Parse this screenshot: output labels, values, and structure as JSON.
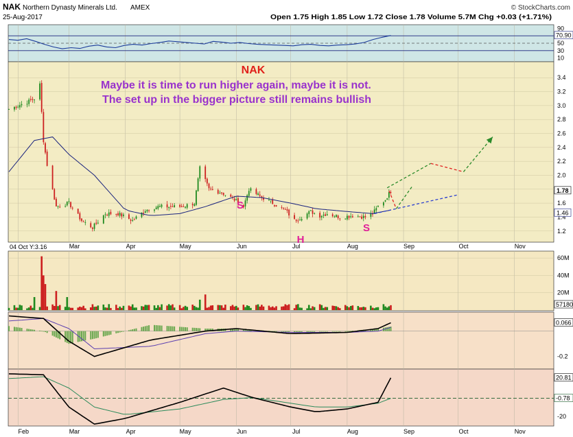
{
  "header": {
    "symbol": "NAK",
    "company": "Northern Dynasty Minerals Ltd.",
    "exchange": "AMEX",
    "date": "25-Aug-2017",
    "brand": "© StockCharts.com",
    "quote": "Open 1.75  High 1.85  Low 1.72  Close 1.78  Volume 5.7M  Chg +0.03 (+1.71%)"
  },
  "annotations": {
    "title": "NAK",
    "line1": "Maybe it is time to run higher again, maybe it is not.",
    "line2": "The set up in the bigger picture still remains bullish",
    "pattern_left_shoulder": "S",
    "pattern_head": "H",
    "pattern_right_shoulder": "S"
  },
  "crosshair_label": "04 Oct Y:3.16",
  "colors": {
    "up": "#1f8a1f",
    "down": "#cc1f1f",
    "ma": "#1a237e",
    "annotation_text": "#9932cc",
    "title_text": "#e0201a",
    "pattern_text": "#e0209a",
    "projection_green": "#2a8a2a",
    "projection_red": "#e02020",
    "projection_blue": "#2b3fd0",
    "rsi_bg": "#cfe6e6",
    "price_bg": "#f3ecc4",
    "volume_bg": "#f5e8c2",
    "macd_bg": "#f7e0c8",
    "osc_bg": "#f5d8c8"
  },
  "chart_data": [
    {
      "type": "line",
      "panel": "RSI",
      "y_ticks": [
        "90",
        "70",
        "50",
        "30",
        "10"
      ],
      "ylim": [
        0,
        100
      ],
      "last_label": "70.90",
      "reference_lines": [
        70,
        50,
        30
      ],
      "series": [
        {
          "values": [
            60,
            58,
            62,
            55,
            47,
            40,
            35,
            38,
            36,
            42,
            45,
            40,
            38,
            44,
            47,
            45,
            49,
            52,
            56,
            54,
            52,
            50,
            48,
            55,
            53,
            50,
            52,
            49,
            47,
            46,
            45,
            44,
            43,
            46,
            47,
            44,
            43,
            45,
            46,
            48,
            52,
            60,
            66,
            70.9
          ]
        }
      ]
    },
    {
      "type": "candlestick",
      "panel": "price",
      "x_ticks": [
        "Feb",
        "Mar",
        "Apr",
        "May",
        "Jun",
        "Jul",
        "Aug",
        "Sep",
        "Oct",
        "Nov"
      ],
      "y_ticks": [
        "3.4",
        "3.2",
        "3.0",
        "2.8",
        "2.6",
        "2.4",
        "2.2",
        "2.0",
        "1.8",
        "1.6",
        "1.4",
        "1.2"
      ],
      "ylim": [
        1.05,
        3.55
      ],
      "last_price_label": "1.78",
      "ma_label": "1.46",
      "series": [
        {
          "name": "price_anchor_dates",
          "values": [
            "2017-01-27",
            "2017-02-01",
            "2017-02-06",
            "2017-02-10",
            "2017-02-13",
            "2017-02-15",
            "2017-02-17",
            "2017-02-22",
            "2017-03-01",
            "2017-03-08",
            "2017-03-14",
            "2017-03-21",
            "2017-03-28",
            "2017-04-05",
            "2017-04-12",
            "2017-04-19",
            "2017-04-25",
            "2017-05-02",
            "2017-05-09",
            "2017-05-12",
            "2017-05-17",
            "2017-05-24",
            "2017-05-31",
            "2017-06-05",
            "2017-06-08",
            "2017-06-14",
            "2017-06-21",
            "2017-06-28",
            "2017-07-03",
            "2017-07-07",
            "2017-07-12",
            "2017-07-17",
            "2017-07-21",
            "2017-07-28",
            "2017-08-04",
            "2017-08-11",
            "2017-08-15",
            "2017-08-18",
            "2017-08-22",
            "2017-08-25"
          ]
        },
        {
          "name": "price_anchor_closes",
          "values": [
            2.95,
            3.0,
            3.05,
            3.1,
            3.3,
            2.5,
            2.15,
            1.55,
            1.6,
            1.35,
            1.25,
            1.45,
            1.45,
            1.35,
            1.5,
            1.55,
            1.55,
            1.55,
            1.6,
            2.1,
            1.8,
            1.75,
            1.65,
            1.55,
            1.8,
            1.7,
            1.6,
            1.5,
            1.35,
            1.4,
            1.48,
            1.42,
            1.45,
            1.4,
            1.42,
            1.4,
            1.45,
            1.55,
            1.65,
            1.78
          ]
        },
        {
          "name": "moving_average_dates",
          "values": [
            "2017-01-27",
            "2017-02-10",
            "2017-02-20",
            "2017-03-01",
            "2017-03-15",
            "2017-04-01",
            "2017-04-15",
            "2017-05-01",
            "2017-05-15",
            "2017-06-01",
            "2017-06-15",
            "2017-07-01",
            "2017-07-15",
            "2017-08-01",
            "2017-08-15",
            "2017-08-25"
          ]
        },
        {
          "name": "moving_average_values",
          "values": [
            2.05,
            2.5,
            2.55,
            2.3,
            2.0,
            1.5,
            1.42,
            1.45,
            1.55,
            1.7,
            1.68,
            1.6,
            1.52,
            1.48,
            1.45,
            1.5
          ]
        }
      ],
      "projections": [
        {
          "color": "green",
          "style": "dashed",
          "from": [
            "2017-08-23",
            1.82
          ],
          "to": [
            "2017-09-16",
            2.17
          ],
          "arrow": false
        },
        {
          "color": "red",
          "style": "dashed",
          "from": [
            "2017-09-16",
            2.17
          ],
          "to": [
            "2017-10-04",
            2.05
          ],
          "arrow": false
        },
        {
          "color": "green",
          "style": "dashed",
          "from": [
            "2017-10-04",
            2.05
          ],
          "to": [
            "2017-10-20",
            2.55
          ],
          "arrow": true
        },
        {
          "color": "red",
          "style": "dashed",
          "from": [
            "2017-08-24",
            1.78
          ],
          "to": [
            "2017-08-28",
            1.52
          ],
          "arrow": false
        },
        {
          "color": "green",
          "style": "dashed",
          "from": [
            "2017-08-28",
            1.52
          ],
          "to": [
            "2017-09-06",
            1.85
          ],
          "arrow": false
        },
        {
          "color": "blue",
          "style": "dashed",
          "from": [
            "2017-08-16",
            1.45
          ],
          "to": [
            "2017-10-01",
            1.72
          ],
          "arrow": false
        }
      ]
    },
    {
      "type": "bar",
      "panel": "volume",
      "y_ticks": [
        "60M",
        "40M",
        "20M"
      ],
      "ylim": [
        0,
        68
      ],
      "last_label": "57180",
      "series": [
        {
          "name": "volume_spikes_dates",
          "values": [
            "2017-02-10",
            "2017-02-14",
            "2017-02-15",
            "2017-02-16",
            "2017-02-22",
            "2017-02-28",
            "2017-05-12",
            "2017-05-15"
          ]
        },
        {
          "name": "volume_spikes_millions",
          "values": [
            15,
            62,
            40,
            30,
            22,
            15,
            12,
            18
          ]
        }
      ]
    },
    {
      "type": "line",
      "panel": "MACD",
      "y_ticks": [
        "-0.2"
      ],
      "last_label": "0.066",
      "ylim": [
        -0.3,
        0.15
      ]
    },
    {
      "type": "line",
      "panel": "oscillator",
      "y_ticks": [
        "-20"
      ],
      "labels": [
        "20.81",
        "-0.78"
      ],
      "ylim": [
        -30,
        30
      ]
    }
  ]
}
